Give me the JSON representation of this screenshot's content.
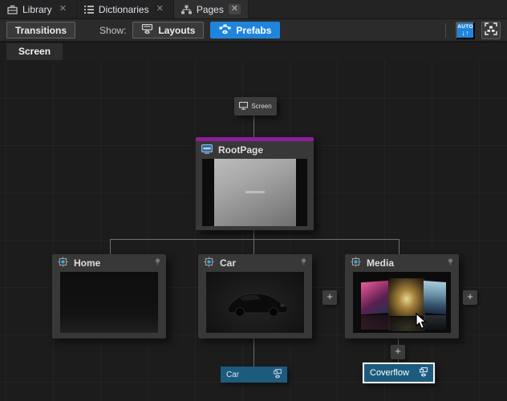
{
  "tabs": [
    {
      "label": "Library",
      "icon": "toolbox-icon",
      "close_symbol": "✕",
      "active": false
    },
    {
      "label": "Dictionaries",
      "icon": "list-icon",
      "close_symbol": "✕",
      "active": false
    },
    {
      "label": "Pages",
      "icon": "sitemap-icon",
      "close_symbol": "✕",
      "active": true
    }
  ],
  "toolbar": {
    "transitions_label": "Transitions",
    "show_label": "Show:",
    "layouts_label": "Layouts",
    "layouts_active": false,
    "prefabs_label": "Prefabs",
    "prefabs_active": true,
    "auto_label": "AUTO",
    "auto_arrows": "↓↑"
  },
  "canvas": {
    "breadcrumb": "Screen",
    "root_node": {
      "title": "Screen",
      "icon": "monitor-icon"
    },
    "page_node": {
      "title": "RootPage",
      "icon": "page-monitor-icon",
      "accent_color": "#8e1d98"
    },
    "child_nodes": [
      {
        "title": "Home",
        "icon": "prefab-chip-icon",
        "right_icon": "bulb-icon"
      },
      {
        "title": "Car",
        "icon": "prefab-chip-icon",
        "right_icon": "bulb-icon"
      },
      {
        "title": "Media",
        "icon": "prefab-chip-icon",
        "right_icon": "bulb-icon"
      }
    ],
    "plus_label": "+",
    "badges": [
      {
        "label": "Car",
        "icon": "prefab-eye-icon",
        "selected": false
      },
      {
        "label": "Coverflow",
        "icon": "prefab-eye-icon",
        "selected": true
      }
    ]
  },
  "colors": {
    "accent_blue": "#1f85dc",
    "rootpage_purple": "#8e1d98",
    "badge_blue": "#1d5b7e",
    "node_bg": "#383838",
    "canvas_bg": "#1c1c1c",
    "wire_gray": "#6e6e6e"
  }
}
